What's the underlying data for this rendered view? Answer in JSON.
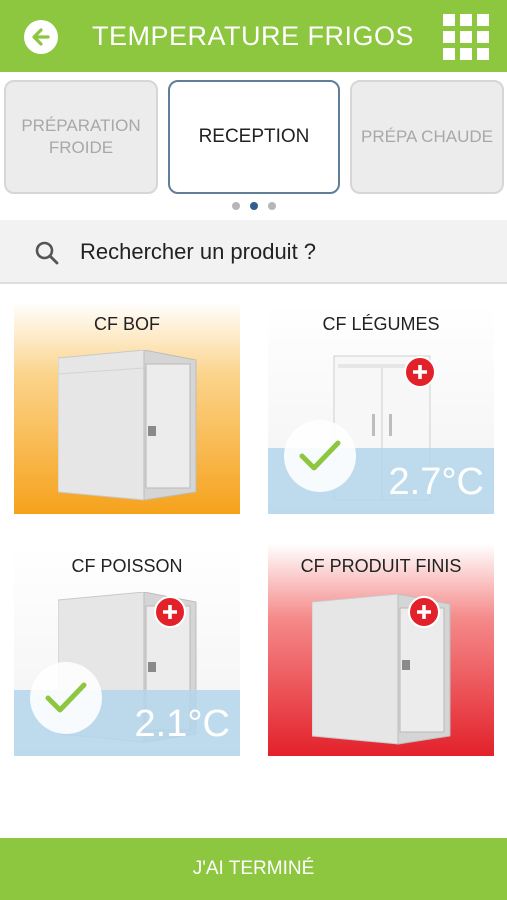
{
  "header": {
    "title": "TEMPERATURE FRIGOS",
    "icons": {
      "back": "arrow-left-icon",
      "menu": "grid-icon"
    },
    "color": "#8dc63f"
  },
  "tabs": [
    {
      "label": "PRÉPARATION FROIDE",
      "active": false
    },
    {
      "label": "RECEPTION",
      "active": true
    },
    {
      "label": "PRÉPA CHAUDE",
      "active": false
    }
  ],
  "pager": {
    "count": 3,
    "active_index": 1
  },
  "search": {
    "placeholder": "Rechercher un produit ?",
    "icon": "search-icon"
  },
  "cards": [
    {
      "name": "CF BOF",
      "status": "warning",
      "temperature": "",
      "checked": false,
      "can_add": false,
      "bg": "orange-gradient"
    },
    {
      "name": "CF LÉGUMES",
      "status": "ok",
      "temperature": "2.7°C",
      "checked": true,
      "can_add": true,
      "bg": "white"
    },
    {
      "name": "CF POISSON",
      "status": "ok",
      "temperature": "2.1°C",
      "checked": true,
      "can_add": true,
      "bg": "white"
    },
    {
      "name": "CF PRODUIT FINIS",
      "status": "alert",
      "temperature": "",
      "checked": false,
      "can_add": true,
      "bg": "red-gradient"
    }
  ],
  "footer": {
    "label": "J'AI TERMINÉ"
  },
  "colors": {
    "accent": "#8dc63f",
    "alert": "#e3212b",
    "warning": "#f5a01a",
    "active_tab_border": "#607d9b",
    "temp_band": "#b4d6eb"
  }
}
